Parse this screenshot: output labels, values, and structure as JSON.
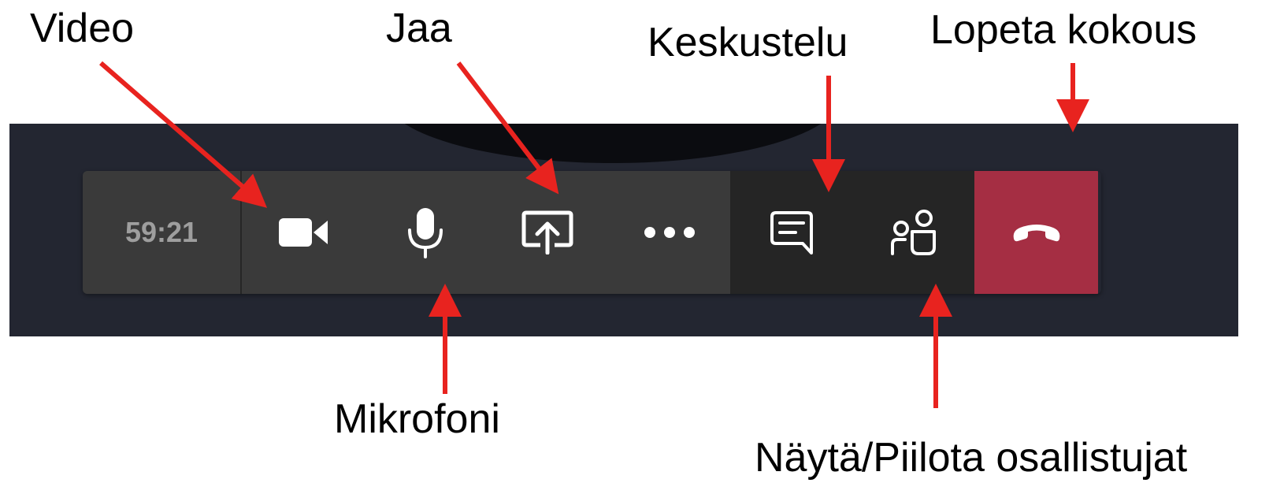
{
  "labels": {
    "video": "Video",
    "share": "Jaa",
    "chat": "Keskustelu",
    "end_meeting": "Lopeta kokous",
    "microphone": "Mikrofoni",
    "participants": "Näytä/Piilota osallistujat"
  },
  "toolbar": {
    "timer": "59:21",
    "buttons": [
      {
        "name": "camera",
        "icon": "camera-icon"
      },
      {
        "name": "microphone",
        "icon": "microphone-icon"
      },
      {
        "name": "share",
        "icon": "share-screen-icon"
      },
      {
        "name": "more",
        "icon": "more-options-icon"
      },
      {
        "name": "chat",
        "icon": "chat-icon"
      },
      {
        "name": "participants",
        "icon": "participants-icon"
      },
      {
        "name": "hang-up",
        "icon": "hang-up-icon"
      }
    ]
  },
  "colors": {
    "arrow": "#e8231f",
    "stage_background": "#232631",
    "toolbar_background": "#3a3a3a",
    "toolbar_side_background": "#252525",
    "hang_up": "#a52e43",
    "icon": "#ffffff",
    "timer_text": "#9e9e9e"
  }
}
